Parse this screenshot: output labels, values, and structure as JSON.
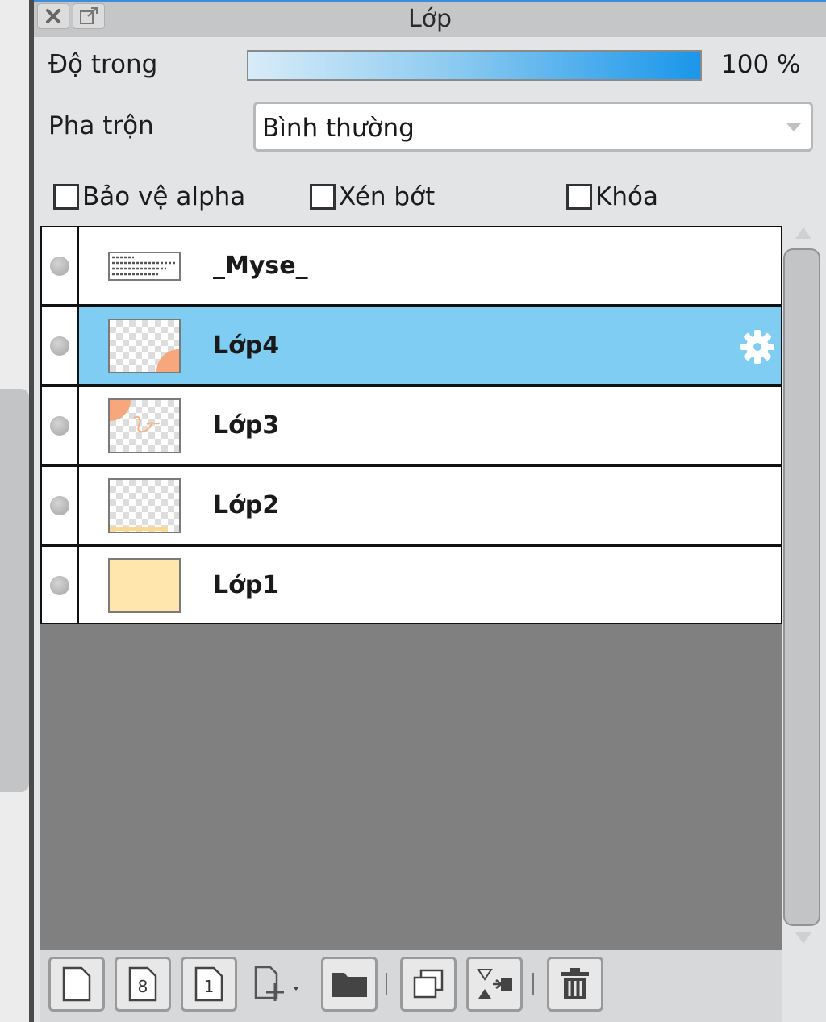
{
  "panel": {
    "title": "Lớp",
    "opacity": {
      "label": "Độ trong",
      "value_text": "100 %",
      "value": 100
    },
    "blend": {
      "label": "Pha trộn",
      "selected": "Bình thường"
    },
    "checkboxes": [
      {
        "label": "Bảo vệ alpha",
        "checked": false
      },
      {
        "label": "Xén bớt",
        "checked": false
      },
      {
        "label": "Khóa",
        "checked": false
      }
    ],
    "layers": [
      {
        "name": "_Myse_",
        "selected": false,
        "thumb": "text"
      },
      {
        "name": "Lớp4",
        "selected": true,
        "thumb": "corner-br"
      },
      {
        "name": "Lớp3",
        "selected": false,
        "thumb": "corner-tl"
      },
      {
        "name": "Lớp2",
        "selected": false,
        "thumb": "bottom-line"
      },
      {
        "name": "Lớp1",
        "selected": false,
        "thumb": "fill"
      }
    ],
    "toolbar_icons": [
      "new-layer-icon",
      "new-8bit-layer-icon",
      "new-1bit-layer-icon",
      "add-layer-menu-icon",
      "new-folder-icon",
      "duplicate-layer-icon",
      "merge-down-icon",
      "delete-layer-icon"
    ]
  },
  "colors": {
    "selected_row": "#80cdf3",
    "accent": "#1a96ea",
    "fill_layer": "#ffe6ad",
    "empty_area": "#808080"
  }
}
